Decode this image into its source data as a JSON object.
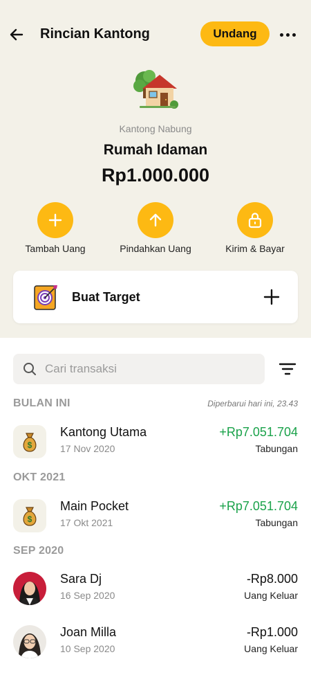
{
  "header": {
    "title": "Rincian Kantong",
    "invite_label": "Undang"
  },
  "pocket": {
    "type": "Kantong Nabung",
    "name": "Rumah Idaman",
    "balance": "Rp1.000.000",
    "icon": "house-icon"
  },
  "actions": [
    {
      "label": "Tambah Uang",
      "icon": "plus-icon"
    },
    {
      "label": "Pindahkan Uang",
      "icon": "arrow-up-icon"
    },
    {
      "label": "Kirim & Bayar",
      "icon": "lock-icon"
    }
  ],
  "target": {
    "label": "Buat Target",
    "icon": "target-icon"
  },
  "search": {
    "placeholder": "Cari transaksi"
  },
  "sections": [
    {
      "title": "BULAN INI",
      "updated": "Diperbarui hari ini, 23.43",
      "transactions": [
        {
          "name": "Kantong Utama",
          "date": "17 Nov 2020",
          "amount": "+Rp7.051.704",
          "category": "Tabungan",
          "icon": "money-bag-icon"
        }
      ]
    },
    {
      "title": "OKT 2021",
      "transactions": [
        {
          "name": "Main Pocket",
          "date": "17 Okt 2021",
          "amount": "+Rp7.051.704",
          "category": "Tabungan",
          "icon": "money-bag-icon"
        }
      ]
    },
    {
      "title": "SEP 2020",
      "transactions": [
        {
          "name": "Sara Dj",
          "date": "16 Sep 2020",
          "amount": "-Rp8.000",
          "category": "Uang Keluar",
          "icon": "avatar"
        },
        {
          "name": "Joan Milla",
          "date": "10 Sep 2020",
          "amount": "-Rp1.000",
          "category": "Uang Keluar",
          "icon": "avatar"
        }
      ]
    }
  ],
  "colors": {
    "accent": "#fdb913",
    "background": "#f3f1e8",
    "positive": "#1aa24a",
    "muted": "#9a9a9a"
  }
}
